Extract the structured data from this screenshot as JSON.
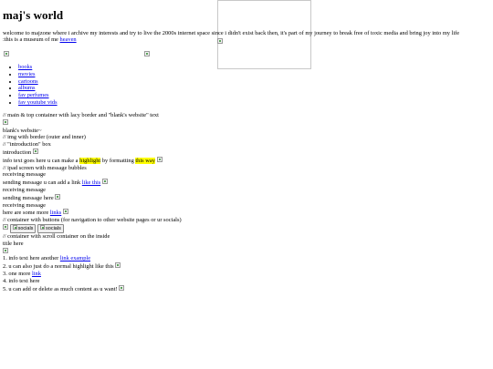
{
  "header": {
    "title": "maj's world",
    "intro_text": "welcome to majzone where i archive my interests and try to live the 2000s internet space since i didn't exist back then, it's part of my journey to break free of toxic media and bring joy into my life",
    "museum_text": ":this is a museum of me",
    "heaven_link": "heaven"
  },
  "nav": {
    "items": [
      {
        "label": "books"
      },
      {
        "label": "movies"
      },
      {
        "label": "cartoons"
      },
      {
        "label": "albums"
      },
      {
        "label": "fav perfumes"
      },
      {
        "label": "fav youtube vids"
      }
    ]
  },
  "main": {
    "comment_main": "// main & top container with lacy border and \"blank's website\" text",
    "blanks_website": "blank's website~",
    "comment_img": "// img with border (outer and inner)",
    "comment_intro_box": "// \"introduction\" box",
    "introduction": "introduction",
    "info_pre": "info text goes here u can make a",
    "info_highlight": "highlight",
    "info_mid": "by formatting",
    "info_this_way": "this way",
    "comment_ipad": "// ipad screen with message bubbles",
    "receiving_1": "receiving message",
    "sending_1_pre": "sending message u can add a link",
    "sending_1_link": "like this",
    "receiving_2": "receiving message",
    "sending_2": "sending message here",
    "receiving_3": "receiving message",
    "more_links_pre": "here are some more",
    "more_links_link": "links",
    "comment_buttons": "// container with buttons (for navigation to other website pages or ur socials)",
    "socials_1": "socials",
    "socials_2": "socials",
    "comment_scroll": "// container with scroll container on the inside",
    "title_here": "title here",
    "list": {
      "item1_pre": "1. info text here another",
      "item1_link": "link example",
      "item2": "2. u can also just do a normal highlight like this",
      "item3_pre": "3. one more",
      "item3_link": "link",
      "item4": "4. info text here",
      "item5": "5. u can add or delete as much content as u want!"
    }
  }
}
